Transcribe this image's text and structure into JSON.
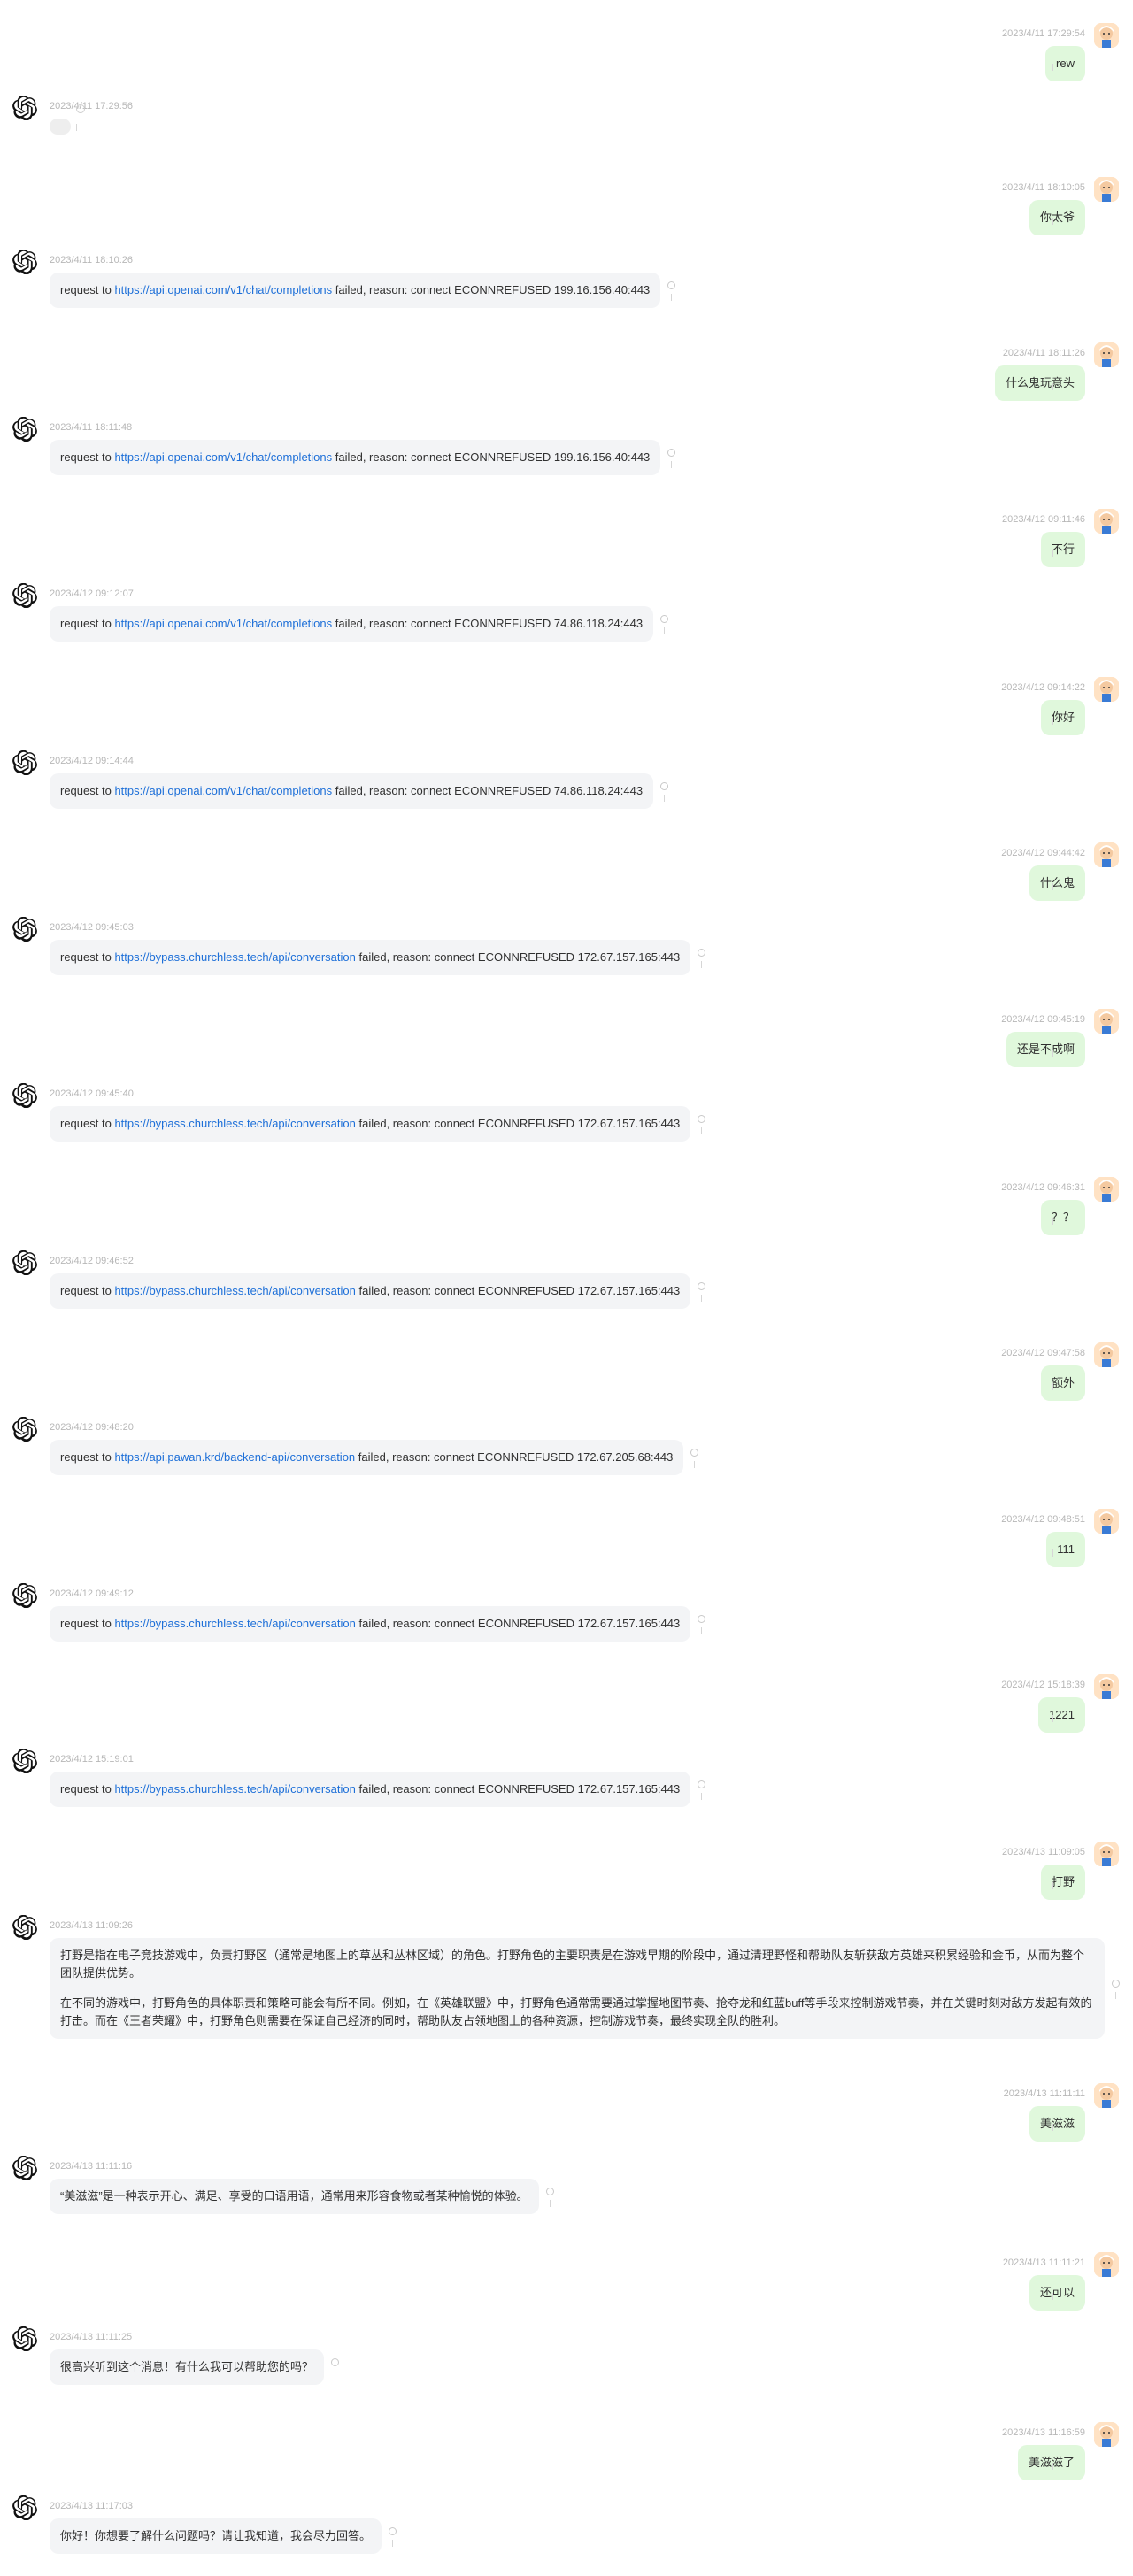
{
  "messages": [
    {
      "role": "user",
      "time": "2023/4/11 17:29:54",
      "text": "rew"
    },
    {
      "role": "assistant",
      "time": "2023/4/11 17:29:56",
      "loading": true
    },
    {
      "role": "user",
      "time": "2023/4/11 18:10:05",
      "text": "你太爷"
    },
    {
      "role": "assistant",
      "time": "2023/4/11 18:10:26",
      "pre": "request to ",
      "link": "https://api.openai.com/v1/chat/completions",
      "post": " failed, reason: connect ECONNREFUSED 199.16.156.40:443"
    },
    {
      "role": "user",
      "time": "2023/4/11 18:11:26",
      "text": "什么鬼玩意头"
    },
    {
      "role": "assistant",
      "time": "2023/4/11 18:11:48",
      "pre": "request to ",
      "link": "https://api.openai.com/v1/chat/completions",
      "post": " failed, reason: connect ECONNREFUSED 199.16.156.40:443"
    },
    {
      "role": "user",
      "time": "2023/4/12 09:11:46",
      "text": "不行"
    },
    {
      "role": "assistant",
      "time": "2023/4/12 09:12:07",
      "pre": "request to ",
      "link": "https://api.openai.com/v1/chat/completions",
      "post": " failed, reason: connect ECONNREFUSED 74.86.118.24:443"
    },
    {
      "role": "user",
      "time": "2023/4/12 09:14:22",
      "text": "你好"
    },
    {
      "role": "assistant",
      "time": "2023/4/12 09:14:44",
      "pre": "request to ",
      "link": "https://api.openai.com/v1/chat/completions",
      "post": " failed, reason: connect ECONNREFUSED 74.86.118.24:443"
    },
    {
      "role": "user",
      "time": "2023/4/12 09:44:42",
      "text": "什么鬼"
    },
    {
      "role": "assistant",
      "time": "2023/4/12 09:45:03",
      "pre": "request to ",
      "link": "https://bypass.churchless.tech/api/conversation",
      "post": " failed, reason: connect ECONNREFUSED 172.67.157.165:443"
    },
    {
      "role": "user",
      "time": "2023/4/12 09:45:19",
      "text": "还是不成啊"
    },
    {
      "role": "assistant",
      "time": "2023/4/12 09:45:40",
      "pre": "request to ",
      "link": "https://bypass.churchless.tech/api/conversation",
      "post": " failed, reason: connect ECONNREFUSED 172.67.157.165:443"
    },
    {
      "role": "user",
      "time": "2023/4/12 09:46:31",
      "text": "？？"
    },
    {
      "role": "assistant",
      "time": "2023/4/12 09:46:52",
      "pre": "request to ",
      "link": "https://bypass.churchless.tech/api/conversation",
      "post": " failed, reason: connect ECONNREFUSED 172.67.157.165:443"
    },
    {
      "role": "user",
      "time": "2023/4/12 09:47:58",
      "text": "额外"
    },
    {
      "role": "assistant",
      "time": "2023/4/12 09:48:20",
      "pre": "request to ",
      "link": "https://api.pawan.krd/backend-api/conversation",
      "post": " failed, reason: connect ECONNREFUSED 172.67.205.68:443"
    },
    {
      "role": "user",
      "time": "2023/4/12 09:48:51",
      "text": "111"
    },
    {
      "role": "assistant",
      "time": "2023/4/12 09:49:12",
      "pre": "request to ",
      "link": "https://bypass.churchless.tech/api/conversation",
      "post": " failed, reason: connect ECONNREFUSED 172.67.157.165:443"
    },
    {
      "role": "user",
      "time": "2023/4/12 15:18:39",
      "text": "1221"
    },
    {
      "role": "assistant",
      "time": "2023/4/12 15:19:01",
      "pre": "request to ",
      "link": "https://bypass.churchless.tech/api/conversation",
      "post": " failed, reason: connect ECONNREFUSED 172.67.157.165:443"
    },
    {
      "role": "user",
      "time": "2023/4/13 11:09:05",
      "text": "打野"
    },
    {
      "role": "assistant",
      "time": "2023/4/13 11:09:26",
      "paragraphs": [
        "打野是指在电子竞技游戏中，负责打野区（通常是地图上的草丛和丛林区域）的角色。打野角色的主要职责是在游戏早期的阶段中，通过清理野怪和帮助队友斩获敌方英雄来积累经验和金币，从而为整个团队提供优势。",
        "在不同的游戏中，打野角色的具体职责和策略可能会有所不同。例如，在《英雄联盟》中，打野角色通常需要通过掌握地图节奏、抢夺龙和红蓝buff等手段来控制游戏节奏，并在关键时刻对敌方发起有效的打击。而在《王者荣耀》中，打野角色则需要在保证自己经济的同时，帮助队友占领地图上的各种资源，控制游戏节奏，最终实现全队的胜利。"
      ]
    },
    {
      "role": "user",
      "time": "2023/4/13 11:11:11",
      "text": "美滋滋"
    },
    {
      "role": "assistant",
      "time": "2023/4/13 11:11:16",
      "text": "“美滋滋”是一种表示开心、满足、享受的口语用语，通常用来形容食物或者某种愉悦的体验。"
    },
    {
      "role": "user",
      "time": "2023/4/13 11:11:21",
      "text": "还可以"
    },
    {
      "role": "assistant",
      "time": "2023/4/13 11:11:25",
      "text": "很高兴听到这个消息！有什么我可以帮助您的吗？"
    },
    {
      "role": "user",
      "time": "2023/4/13 11:16:59",
      "text": "美滋滋了"
    },
    {
      "role": "assistant",
      "time": "2023/4/13 11:17:03",
      "text": "你好！你想要了解什么问题吗？请让我知道，我会尽力回答。"
    }
  ],
  "colors": {
    "user_bubble": "#e0f8dc",
    "bot_bubble": "#f3f4f6",
    "link": "#1d6fd8",
    "timestamp": "#b7b7b7"
  },
  "icons": {
    "user_avatar": "user-avatar-icon",
    "bot_avatar": "openai-logo-icon"
  }
}
